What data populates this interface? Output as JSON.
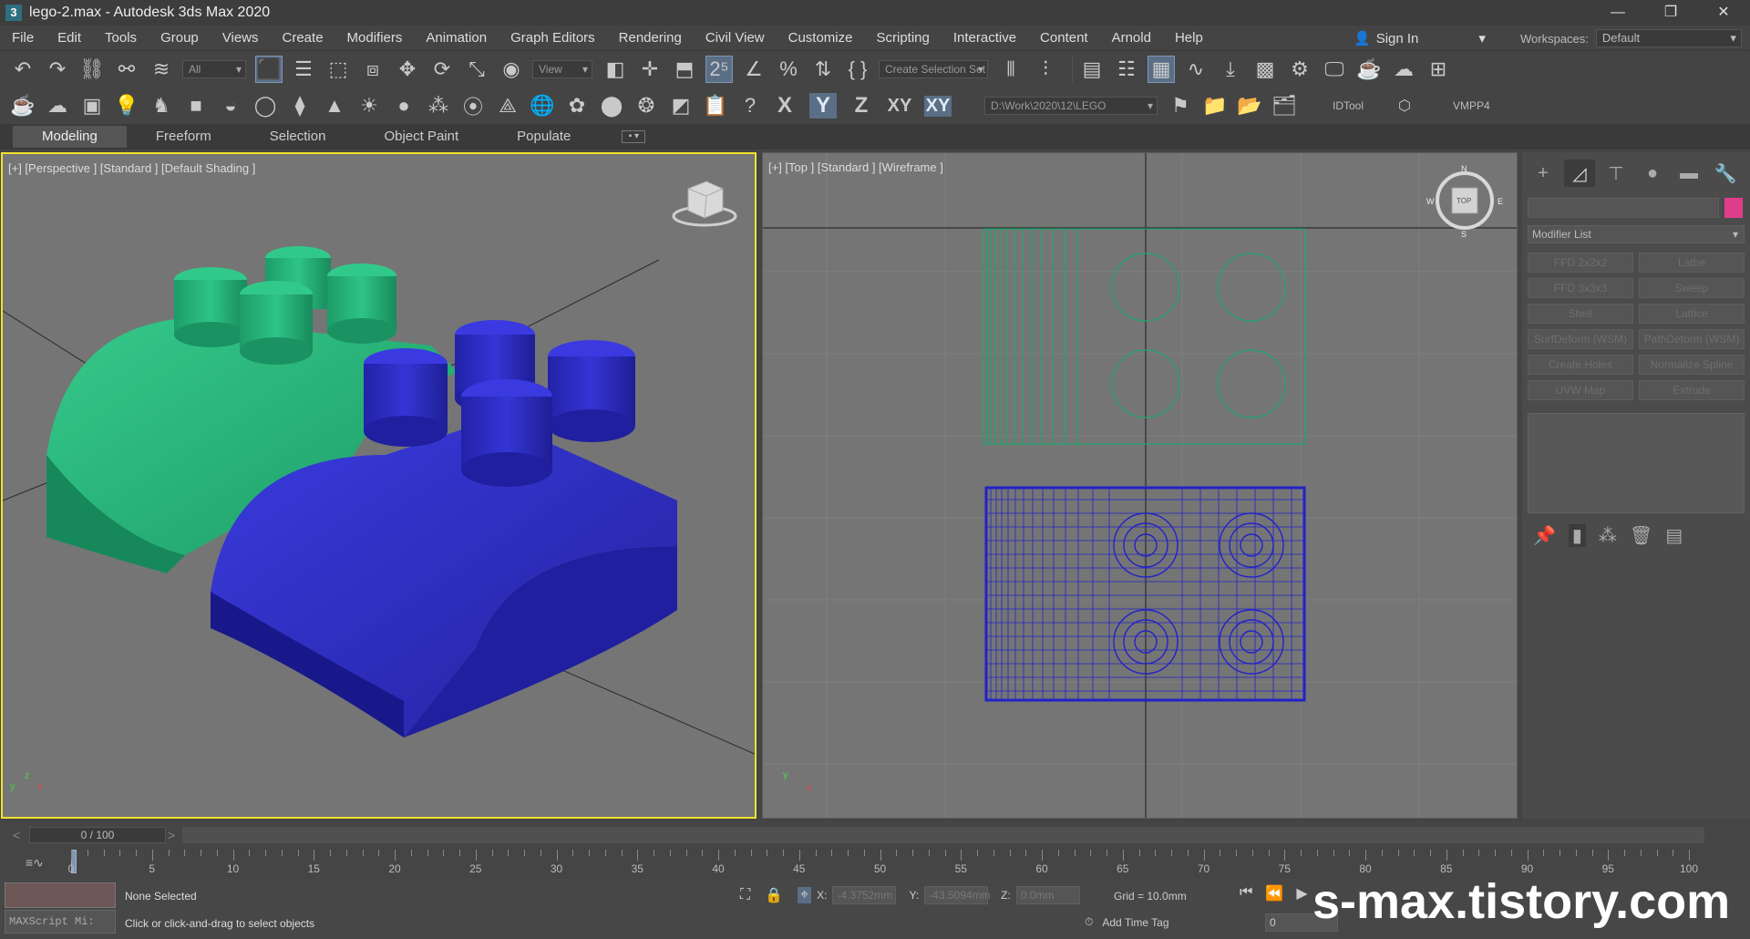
{
  "titlebar": {
    "app_icon": "3",
    "title": "lego-2.max - Autodesk 3ds Max 2020",
    "minimize": "—",
    "restore": "❐",
    "close": "✕"
  },
  "menu": [
    {
      "label": "File"
    },
    {
      "label": "Edit"
    },
    {
      "label": "Tools"
    },
    {
      "label": "Group"
    },
    {
      "label": "Views"
    },
    {
      "label": "Create"
    },
    {
      "label": "Modifiers"
    },
    {
      "label": "Animation"
    },
    {
      "label": "Graph Editors"
    },
    {
      "label": "Rendering"
    },
    {
      "label": "Civil View"
    },
    {
      "label": "Customize"
    },
    {
      "label": "Scripting"
    },
    {
      "label": "Interactive"
    },
    {
      "label": "Content"
    },
    {
      "label": "Arnold"
    },
    {
      "label": "Help"
    }
  ],
  "signin": {
    "label": "Sign In",
    "icon": "user-icon"
  },
  "workspaces": {
    "label": "Workspaces:",
    "value": "Default"
  },
  "toolbar1": {
    "filter_value": "All",
    "refcoord_value": "View",
    "selection_set": "Create Selection Set"
  },
  "toolbar2": {
    "axis_x": "X",
    "axis_y": "Y",
    "axis_z": "Z",
    "axis_xy": "XY",
    "axis_xyy": "XY",
    "project_path": "D:\\Work\\2020\\12\\LEGO",
    "idtool": "IDTool",
    "vmpp4": "VMPP4"
  },
  "ribbon": {
    "tabs": [
      {
        "label": "Modeling"
      },
      {
        "label": "Freeform"
      },
      {
        "label": "Selection"
      },
      {
        "label": "Object Paint"
      },
      {
        "label": "Populate"
      }
    ],
    "options": "▪ ▾"
  },
  "viewports": {
    "perspective_label": "[+] [Perspective ] [Standard ] [Default Shading ]",
    "top_label": "[+] [Top ] [Standard ] [Wireframe ]",
    "axis_x": "x",
    "axis_y": "y",
    "axis_z": "z",
    "compass": {
      "n": "N",
      "s": "S",
      "e": "E",
      "w": "W",
      "top": "TOP"
    }
  },
  "colors": {
    "green_brick": "#1fa870",
    "blue_brick": "#2727b8",
    "active_border": "#f0e12c",
    "color_swatch": "#e03c8c"
  },
  "command_panel": {
    "modifier_list": "Modifier List",
    "modifiers": [
      {
        "label": "FFD 2x2x2"
      },
      {
        "label": "Lathe"
      },
      {
        "label": "FFD 3x3x3"
      },
      {
        "label": "Sweep"
      },
      {
        "label": "Shell"
      },
      {
        "label": "Lattice"
      },
      {
        "label": "SurfDeform (WSM)"
      },
      {
        "label": "PathDeform (WSM)"
      },
      {
        "label": "Create Holes"
      },
      {
        "label": "Normalize Spline"
      },
      {
        "label": "UVW Map"
      },
      {
        "label": "Extrude"
      }
    ]
  },
  "timeslider": {
    "frame": "0 / 100",
    "prev": "<",
    "next": ">"
  },
  "trackbar": {
    "ticks": [
      "0",
      "5",
      "10",
      "15",
      "20",
      "25",
      "30",
      "35",
      "40",
      "45",
      "50",
      "55",
      "60",
      "65",
      "70",
      "75",
      "80",
      "85",
      "90",
      "95",
      "100"
    ]
  },
  "statusbar": {
    "maxscript": "MAXScript Mi:",
    "selection": "None Selected",
    "prompt": "Click or click-and-drag to select objects",
    "x_label": "X:",
    "x_value": "-4.3752mm",
    "y_label": "Y:",
    "y_value": "-43.5094mm",
    "z_label": "Z:",
    "z_value": "0.0mm",
    "grid": "Grid = 10.0mm",
    "add_time_tag": "Add Time Tag",
    "frame_value": "0"
  },
  "watermark": "s-max.tistory.com"
}
